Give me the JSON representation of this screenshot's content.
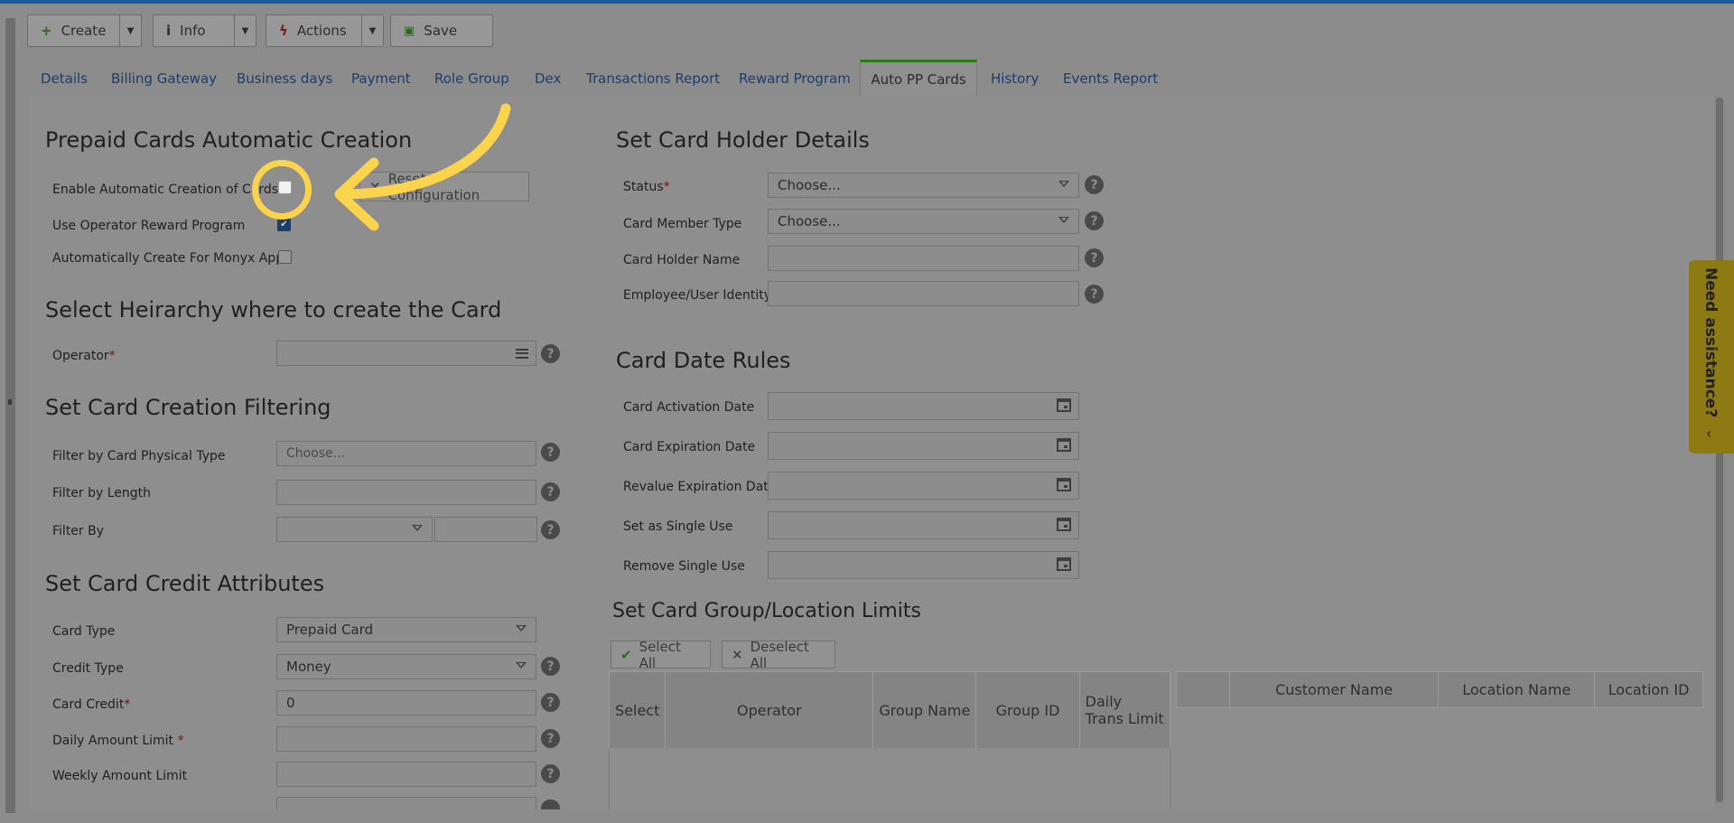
{
  "toolbar": {
    "create_label": "Create",
    "info_label": "Info",
    "actions_label": "Actions",
    "save_label": "Save"
  },
  "tabs": [
    {
      "label": "Details"
    },
    {
      "label": "Billing Gateway"
    },
    {
      "label": "Business days"
    },
    {
      "label": "Payment"
    },
    {
      "label": "Role Group"
    },
    {
      "label": "Dex"
    },
    {
      "label": "Transactions Report"
    },
    {
      "label": "Reward Program"
    },
    {
      "label": "Auto PP Cards",
      "active": true
    },
    {
      "label": "History"
    },
    {
      "label": "Events Report"
    }
  ],
  "auto_creation": {
    "title": "Prepaid Cards Automatic Creation",
    "enable_label": "Enable Automatic Creation of Cards",
    "enable_checked": false,
    "reset_label": "Reset Configuration",
    "reward_label": "Use Operator Reward Program",
    "reward_checked": true,
    "monyx_label": "Automatically Create For Monyx App",
    "monyx_checked": false
  },
  "hierarchy": {
    "title": "Select Heirarchy where to create the Card",
    "operator_label": "Operator",
    "operator_value": ""
  },
  "filtering": {
    "title": "Set Card Creation Filtering",
    "physical_type_label": "Filter by Card Physical Type",
    "physical_type_placeholder": "Choose...",
    "length_label": "Filter by Length",
    "filter_by_label": "Filter By"
  },
  "credit": {
    "title": "Set Card Credit Attributes",
    "card_type_label": "Card Type",
    "card_type_value": "Prepaid Card",
    "credit_type_label": "Credit Type",
    "credit_type_value": "Money",
    "card_credit_label": "Card Credit",
    "card_credit_value": "0",
    "daily_limit_label": "Daily Amount Limit",
    "weekly_limit_label": "Weekly Amount Limit"
  },
  "holder": {
    "title": "Set Card Holder Details",
    "status_label": "Status",
    "status_value": "Choose...",
    "member_type_label": "Card Member Type",
    "member_type_value": "Choose...",
    "holder_name_label": "Card Holder Name",
    "identity_label": "Employee/User Identity"
  },
  "date_rules": {
    "title": "Card Date Rules",
    "activation_label": "Card Activation Date",
    "expiration_label": "Card Expiration Date",
    "revalue_label": "Revalue Expiration Date",
    "single_use_label": "Set as Single Use",
    "remove_single_label": "Remove Single Use"
  },
  "limits": {
    "title": "Set Card Group/Location Limits",
    "select_all_label": "Select All",
    "deselect_all_label": "Deselect All",
    "left_columns": [
      "Select",
      "Operator",
      "Group Name",
      "Group ID",
      "Daily Trans Limit"
    ],
    "right_columns": [
      "",
      "Customer Name",
      "Location Name",
      "Location ID"
    ]
  },
  "assist": {
    "label": "Need assistance?"
  },
  "colors": {
    "highlight": "#fcd34d",
    "tab_active_border": "#2d7a1b",
    "overlay_bg": "#8e8e8e"
  }
}
